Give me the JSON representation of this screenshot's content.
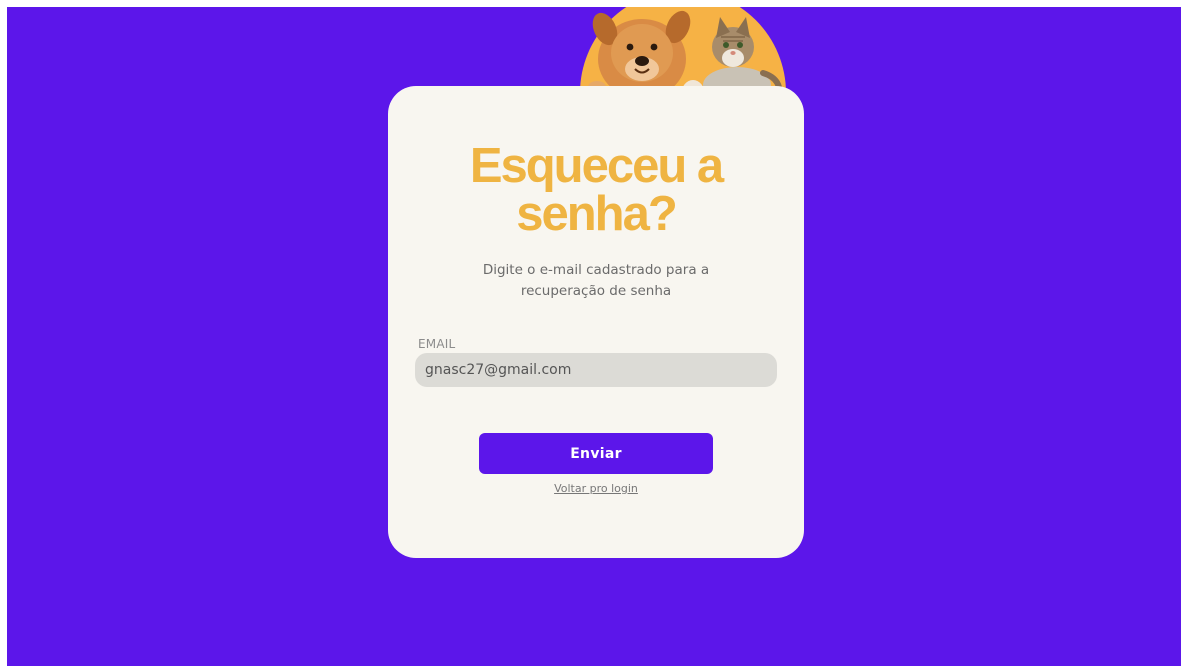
{
  "colors": {
    "background": "#5c16ea",
    "card": "#f8f6f0",
    "title": "#efb442",
    "button": "#5c16ea",
    "input": "#dcdbd6"
  },
  "hero_image": "dog-and-cat-illustration",
  "form": {
    "title_line1": "Esqueceu a",
    "title_line2": "senha?",
    "subtitle_line1": "Digite o e-mail cadastrado para a",
    "subtitle_line2": "recuperação de senha",
    "email_label": "EMAIL",
    "email_value": "gnasc27@gmail.com",
    "submit_label": "Enviar",
    "back_link": "Voltar pro login"
  }
}
